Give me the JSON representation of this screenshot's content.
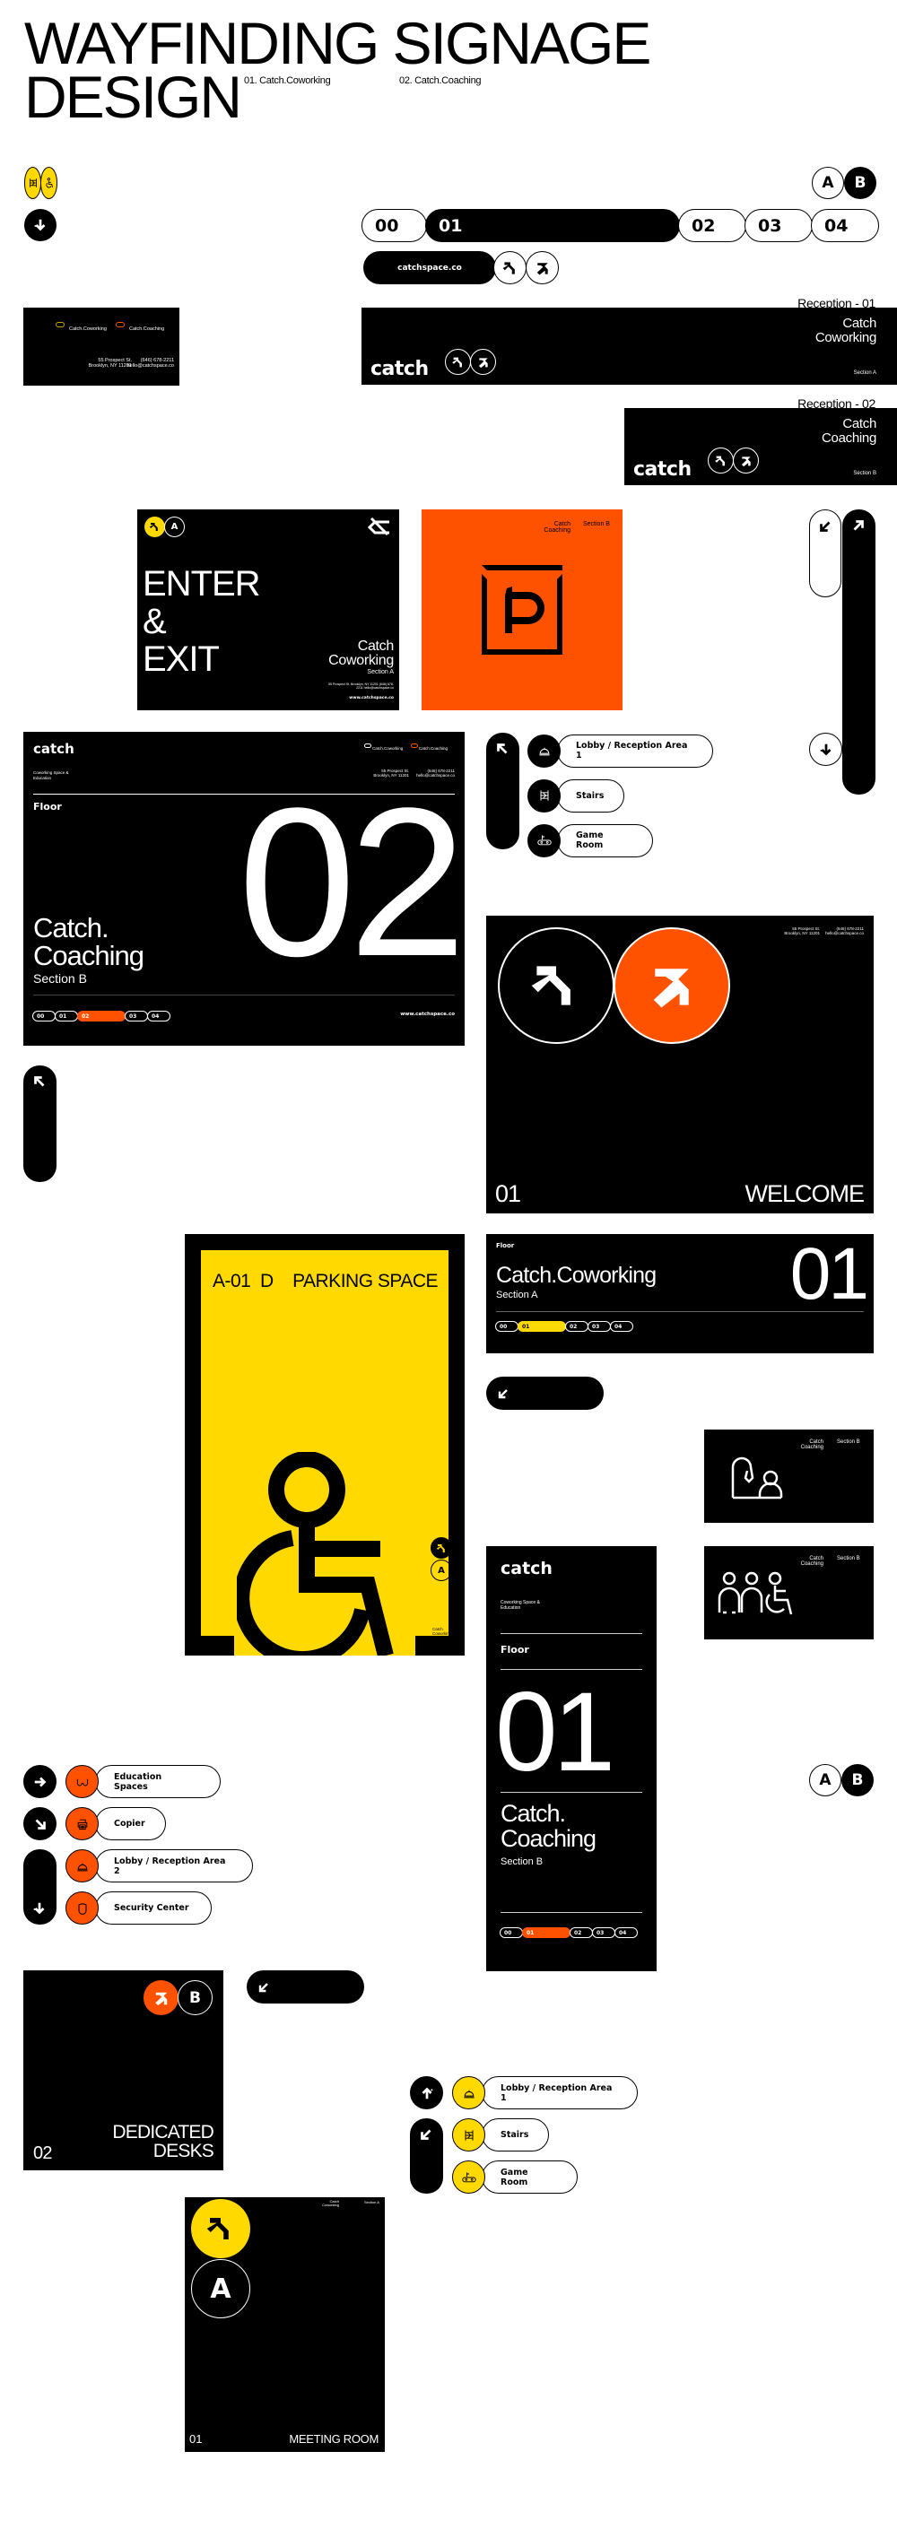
{
  "header": {
    "title_line1": "WAYFINDING SIGNAGE",
    "title_line2": "DESIGN",
    "subtitle1": "01. Catch.Coworking",
    "subtitle2": "02. Catch.Coaching"
  },
  "colors": {
    "black": "#000000",
    "white": "#ffffff",
    "yellow": "#FFD900",
    "orange": "#FF5200"
  },
  "top_icons": {
    "stairs_icon": "stairs-icon",
    "accessible_icon": "wheelchair-icon",
    "down_arrow_icon": "arrow-down-icon",
    "section_a": "A",
    "section_b": "B"
  },
  "floor_nav_large": {
    "floors": [
      "00",
      "01",
      "02",
      "03",
      "04"
    ],
    "active": "01"
  },
  "url_pill": {
    "label": "catchspace.co"
  },
  "business_card": {
    "brand1": "Catch.Coworking",
    "brand1_badge": "01",
    "brand2": "Catch.Coaching",
    "brand2_badge": "02",
    "address_line1": "55 Prospect St.",
    "address_line2": "Brooklyn, NY 11201",
    "phone": "(646) 678-2211",
    "email": "hello@catchspace.co"
  },
  "reception_signs": [
    {
      "caption": "Reception - 01",
      "logo": "catch",
      "name_line1": "Catch",
      "name_line2": "Coworking",
      "section": "Section A"
    },
    {
      "caption": "Reception - 02",
      "logo": "catch",
      "name_line1": "Catch",
      "name_line2": "Coaching",
      "section": "Section B"
    }
  ],
  "enter_exit_sign": {
    "section_badge": "A",
    "line1": "ENTER",
    "line2": "&",
    "line3": "EXIT",
    "name_line1": "Catch",
    "name_line2": "Coworking",
    "section": "Section A",
    "address": "55 Prospect St. Brooklyn, NY 11201",
    "contact": "(646) 678-2211 hello@catchspace.co",
    "url": "www.catchspace.co"
  },
  "parking_sign_orange": {
    "name_line1": "Catch",
    "name_line2": "Coaching",
    "section": "Section B",
    "symbol": "P"
  },
  "floor_sign_02": {
    "logo": "catch",
    "tagline": "Coworking Space & Education",
    "brand1": "Catch.Coworking",
    "brand2": "Catch.Coaching",
    "address_line1": "55 Prospect St.",
    "address_line2": "Brooklyn, NY 11201",
    "phone": "(646) 678-2211",
    "email": "hello@catchspace.co",
    "floor_label": "Floor",
    "floor_number": "02",
    "name_line1": "Catch.",
    "name_line2": "Coaching",
    "section": "Section B",
    "floors": [
      "00",
      "01",
      "02",
      "03",
      "04"
    ],
    "active": "02",
    "url": "www.catchspace.co"
  },
  "directory_1": {
    "items": [
      {
        "icon": "bell-icon",
        "label": "Lobby / Reception Area 1"
      },
      {
        "icon": "stairs-icon",
        "label": "Stairs"
      },
      {
        "icon": "game-controller-icon",
        "label": "Game Room"
      }
    ]
  },
  "welcome_sign": {
    "address_line1": "55 Prospect St.",
    "address_line2": "Brooklyn, NY 11201",
    "phone": "(646) 678-2211",
    "email": "hello@catchspace.co",
    "number": "01",
    "label": "WELCOME"
  },
  "parking_space_sign": {
    "code": "A-01",
    "letter": "D",
    "label": "PARKING SPACE",
    "section_badge": "A",
    "name_line1": "Catch.",
    "name_line2": "Coworking",
    "section": "Section A"
  },
  "floor_sign_01_wide": {
    "floor_label": "Floor",
    "name": "Catch.Coworking",
    "section": "Section A",
    "floor_number": "01",
    "floors": [
      "00",
      "01",
      "02",
      "03",
      "04"
    ],
    "active": "01"
  },
  "restroom_signs": [
    {
      "name_line1": "Catch",
      "name_line2": "Coaching",
      "section": "Section B",
      "icon": "reception-person-icon"
    },
    {
      "name_line1": "Catch",
      "name_line2": "Coaching",
      "section": "Section B",
      "icon": "restroom-people-accessible-icon"
    }
  ],
  "floor_sign_01_tall": {
    "logo": "catch",
    "tagline_line1": "Coworking Space &",
    "tagline_line2": "Education",
    "floor_label": "Floor",
    "floor_number": "01",
    "name_line1": "Catch.",
    "name_line2": "Coaching",
    "section": "Section B",
    "floors": [
      "00",
      "01",
      "02",
      "03",
      "04"
    ],
    "active": "01"
  },
  "directory_2": {
    "items": [
      {
        "icon": "glasses-icon",
        "label": "Education Spaces",
        "arrow": "arrow-right-icon"
      },
      {
        "icon": "printer-icon",
        "label": "Copier",
        "arrow": "arrow-down-right-icon"
      },
      {
        "icon": "bell-icon",
        "label": "Lobby / Reception Area 2",
        "arrow": ""
      },
      {
        "icon": "shield-icon",
        "label": "Security Center",
        "arrow": "arrow-down-icon"
      }
    ]
  },
  "section_badges_2": {
    "a": "A",
    "b": "B"
  },
  "dedicated_desks_sign": {
    "section_badge": "B",
    "number": "02",
    "label_line1": "DEDICATED",
    "label_line2": "DESKS"
  },
  "directory_3": {
    "items": [
      {
        "icon": "bell-icon",
        "label": "Lobby / Reception Area 1"
      },
      {
        "icon": "stairs-icon",
        "label": "Stairs"
      },
      {
        "icon": "game-controller-icon",
        "label": "Game Room"
      }
    ]
  },
  "meeting_room_sign": {
    "name_line1": "Catch",
    "name_line2": "Coworking",
    "section": "Section A",
    "section_badge": "A",
    "number": "01",
    "label": "MEETING ROOM"
  }
}
